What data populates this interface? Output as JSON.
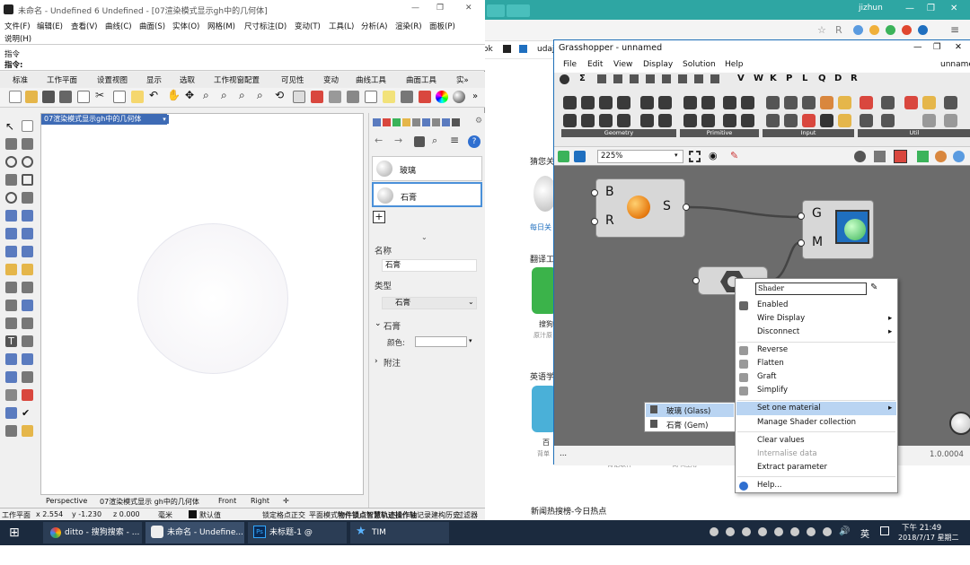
{
  "browser": {
    "user": "jizhun",
    "bookmarks": [
      "ok",
      "udaj"
    ],
    "side_texts": [
      "猜您关",
      "每日关",
      "翻译工",
      "搜狗",
      "原汁原",
      "英语学",
      "百",
      "背单"
    ],
    "bottom_texts": [
      "背记软件",
      "词书应用"
    ],
    "news_title": "新闻热搜榜-今日热点"
  },
  "rhino": {
    "title": "未命名 - Undefined 6 Undefined - [07渲染模式显示gh中的几何体]",
    "menu": [
      "文件(F)",
      "编辑(E)",
      "查看(V)",
      "曲线(C)",
      "曲面(S)",
      "实体(O)",
      "网格(M)",
      "尺寸标注(D)",
      "变动(T)",
      "工具(L)",
      "分析(A)",
      "渲染(R)",
      "面板(P)",
      "说明(H)"
    ],
    "command_lines": [
      "指令",
      "指令:"
    ],
    "tabs": [
      "标准",
      "工作平面",
      "设置视图",
      "显示",
      "选取",
      "工作视窗配置",
      "可见性",
      "变动",
      "曲线工具",
      "曲面工具",
      "实»"
    ],
    "viewport_title": "07渲染模式显示gh中的几何体",
    "viewport_tabs": [
      "Perspective",
      "07渲染模式显示 gh中的几何体",
      "Front",
      "Right",
      "✛"
    ],
    "materials": [
      "玻璃",
      "石膏"
    ],
    "panel": {
      "name_label": "名称",
      "name_value": "石膏",
      "type_label": "类型",
      "type_value": "石膏",
      "section": "石膏",
      "color_label": "颜色:",
      "attach": "附注"
    },
    "status": [
      "工作平面",
      "x 2.554",
      "y -1.230",
      "z 0.000",
      "毫米",
      "默认值",
      "锁定格点",
      "正交",
      "平面模式",
      "物件锁点",
      "智慧轨迹",
      "操作轴",
      "记录建构历史",
      "过滤器"
    ]
  },
  "gh": {
    "title": "Grasshopper - unnamed",
    "doc_name": "unnamed",
    "menu": [
      "File",
      "Edit",
      "View",
      "Display",
      "Solution",
      "Help"
    ],
    "letter_tabs": [
      "Σ",
      "V",
      "W",
      "K",
      "P",
      "L",
      "Q",
      "D",
      "R"
    ],
    "ribbon_groups": [
      "Geometry",
      "Primitive",
      "Input",
      "Util"
    ],
    "zoom": "225%",
    "version": "1.0.0004",
    "status_left": "...",
    "comp1": {
      "in1": "B",
      "in2": "R",
      "out": "S"
    },
    "comp2": {
      "in1": "G",
      "in2": "M"
    }
  },
  "context_menu": {
    "name_field": "Shader",
    "items": [
      "Enabled",
      "Wire Display",
      "Disconnect",
      "Reverse",
      "Flatten",
      "Graft",
      "Simplify",
      "Set one material",
      "Manage Shader collection",
      "Clear values",
      "Internalise data",
      "Extract parameter",
      "Help..."
    ],
    "submenu": [
      "玻璃 (Glass)",
      "石膏 (Gem)"
    ]
  },
  "taskbar": {
    "items": [
      "ditto - 搜狗搜索 - ...",
      "未命名 - Undefine...",
      "未标题-1 @ 80.5%...",
      "TIM"
    ],
    "lang": "英",
    "time": "下午 21:49",
    "date": "2018/7/17 星期二"
  }
}
